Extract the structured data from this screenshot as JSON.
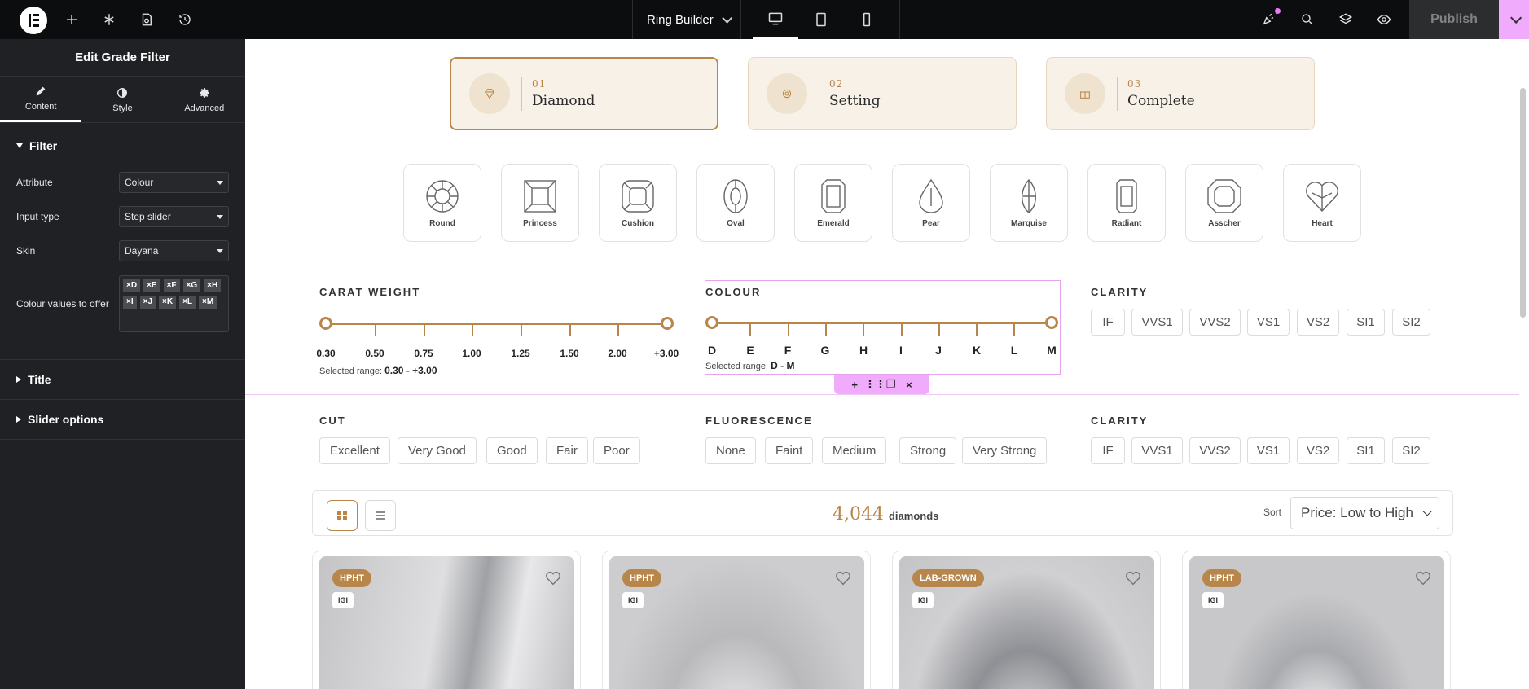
{
  "topbar": {
    "page_name": "Ring Builder",
    "publish_label": "Publish"
  },
  "panel": {
    "title": "Edit Grade Filter",
    "tabs": [
      {
        "label": "Content"
      },
      {
        "label": "Style"
      },
      {
        "label": "Advanced"
      }
    ],
    "filter_section": "Filter",
    "controls": {
      "attribute_label": "Attribute",
      "attribute_value": "Colour",
      "input_type_label": "Input type",
      "input_type_value": "Step slider",
      "skin_label": "Skin",
      "skin_value": "Dayana",
      "colour_values_label": "Colour values to offer",
      "colour_values": [
        "×D",
        "×E",
        "×F",
        "×G",
        "×H",
        "×I",
        "×J",
        "×K",
        "×L",
        "×M"
      ]
    },
    "sections": [
      "Title",
      "Slider options"
    ]
  },
  "steps": [
    {
      "num": "01",
      "name": "Diamond"
    },
    {
      "num": "02",
      "name": "Setting"
    },
    {
      "num": "03",
      "name": "Complete"
    }
  ],
  "shapes": [
    "Round",
    "Princess",
    "Cushion",
    "Oval",
    "Emerald",
    "Pear",
    "Marquise",
    "Radiant",
    "Asscher",
    "Heart"
  ],
  "carat": {
    "label": "CARAT WEIGHT",
    "ticks": [
      "0.30",
      "0.50",
      "0.75",
      "1.00",
      "1.25",
      "1.50",
      "2.00",
      "+3.00"
    ],
    "range_prefix": "Selected range:",
    "range_value": "0.30 - +3.00"
  },
  "colour": {
    "label": "COLOUR",
    "ticks": [
      "D",
      "E",
      "F",
      "G",
      "H",
      "I",
      "J",
      "K",
      "L",
      "M"
    ],
    "range_prefix": "Selected range:",
    "range_value": "D - M"
  },
  "clarity_top": {
    "label": "CLARITY",
    "options": [
      "IF",
      "VVS1",
      "VVS2",
      "VS1",
      "VS2",
      "SI1",
      "SI2"
    ]
  },
  "cut": {
    "label": "CUT",
    "options": [
      "Excellent",
      "Very Good",
      "Good",
      "Fair",
      "Poor"
    ]
  },
  "fluorescence": {
    "label": "FLUORESCENCE",
    "options": [
      "None",
      "Faint",
      "Medium",
      "Strong",
      "Very Strong"
    ]
  },
  "clarity_bottom": {
    "label": "CLARITY",
    "options": [
      "IF",
      "VVS1",
      "VVS2",
      "VS1",
      "VS2",
      "SI1",
      "SI2"
    ]
  },
  "results": {
    "count": "4,044",
    "count_word": "diamonds",
    "sort_label": "Sort",
    "sort_value": "Price: Low to High"
  },
  "cards": [
    {
      "badge": "HPHT",
      "lab": "IGI"
    },
    {
      "badge": "HPHT",
      "lab": "IGI"
    },
    {
      "badge": "LAB-GROWN",
      "lab": "IGI"
    },
    {
      "badge": "HPHT",
      "lab": "IGI"
    }
  ],
  "colors": {
    "accent_gold": "#b8864b",
    "edit_pink": "#f0abfc",
    "panel_bg": "#1f2124",
    "topbar_bg": "#0c0d0e"
  }
}
